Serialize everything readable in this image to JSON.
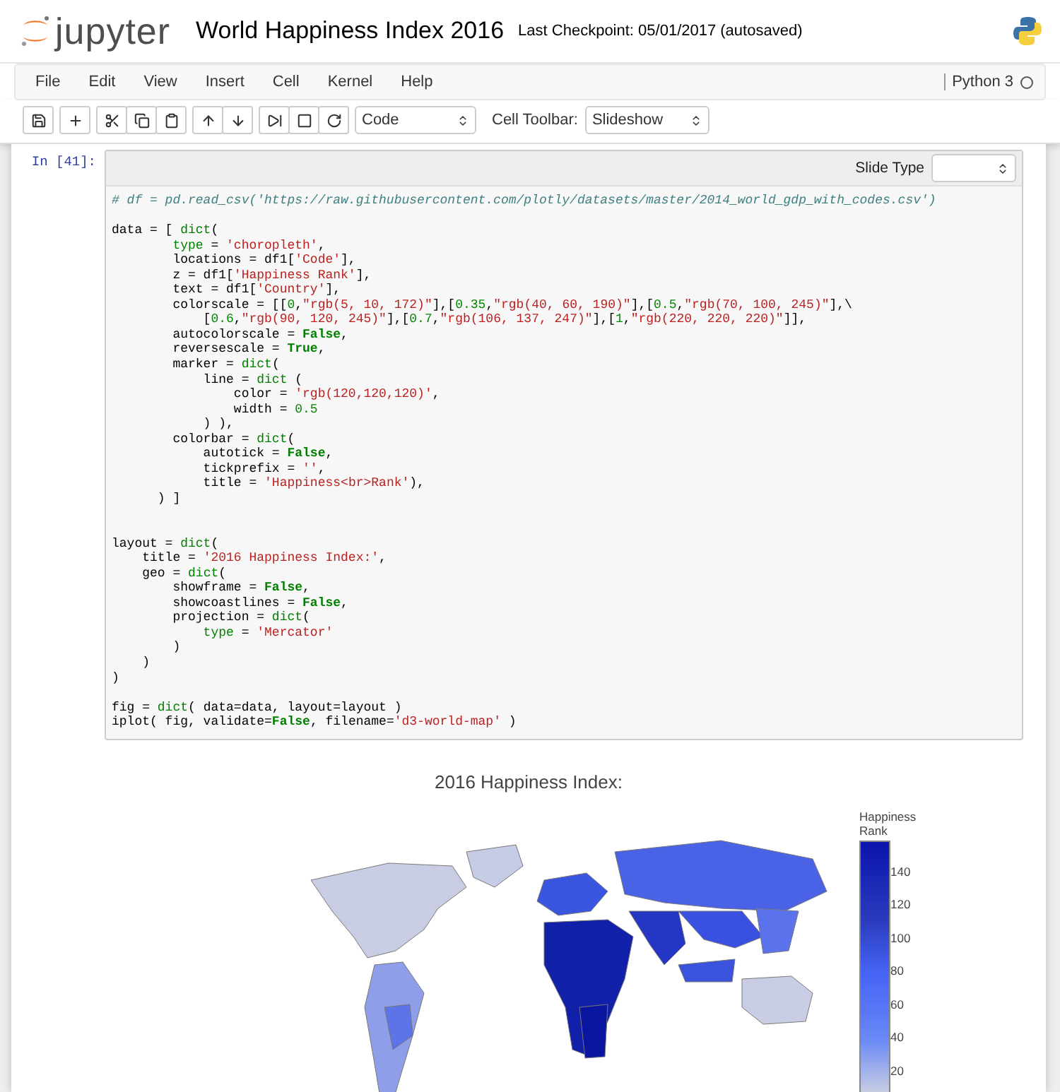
{
  "header": {
    "logo_text": "jupyter",
    "notebook_title": "World Happiness Index 2016",
    "checkpoint": "Last Checkpoint: 05/01/2017 (autosaved)"
  },
  "menu": [
    "File",
    "Edit",
    "View",
    "Insert",
    "Cell",
    "Kernel",
    "Help"
  ],
  "kernel": {
    "name": "Python 3",
    "busy": false
  },
  "toolbar": {
    "cell_type": "Code",
    "cell_toolbar_label": "Cell Toolbar:",
    "cell_toolbar_value": "Slideshow"
  },
  "cell": {
    "prompt": "In [41]:",
    "slide_type_label": "Slide Type",
    "code": [
      {
        "tokens": [
          {
            "kind": "comment",
            "text": "# df = pd.read_csv('https://raw.githubusercontent.com/plotly/datasets/master/2014_world_gdp_with_codes.csv')"
          }
        ]
      },
      {
        "blank_before": true,
        "tokens": [
          {
            "kind": "plain",
            "text": "data = [ "
          },
          {
            "kind": "builtin",
            "text": "dict"
          },
          {
            "kind": "plain",
            "text": "("
          }
        ]
      },
      {
        "tokens": [
          {
            "kind": "builtin",
            "text": "        type"
          },
          {
            "kind": "plain",
            "text": " = "
          },
          {
            "kind": "string",
            "text": "'choropleth'"
          },
          {
            "kind": "plain",
            "text": ","
          }
        ]
      },
      {
        "tokens": [
          {
            "kind": "plain",
            "text": "        locations = df1["
          },
          {
            "kind": "string",
            "text": "'Code'"
          },
          {
            "kind": "plain",
            "text": "],"
          }
        ]
      },
      {
        "tokens": [
          {
            "kind": "plain",
            "text": "        z = df1["
          },
          {
            "kind": "string",
            "text": "'Happiness Rank'"
          },
          {
            "kind": "plain",
            "text": "],"
          }
        ]
      },
      {
        "tokens": [
          {
            "kind": "plain",
            "text": "        text = df1["
          },
          {
            "kind": "string",
            "text": "'Country'"
          },
          {
            "kind": "plain",
            "text": "],"
          }
        ]
      },
      {
        "tokens": [
          {
            "kind": "plain",
            "text": "        colorscale = [["
          },
          {
            "kind": "number",
            "text": "0"
          },
          {
            "kind": "plain",
            "text": ","
          },
          {
            "kind": "string",
            "text": "\"rgb(5, 10, 172)\""
          },
          {
            "kind": "plain",
            "text": "],["
          },
          {
            "kind": "number",
            "text": "0.35"
          },
          {
            "kind": "plain",
            "text": ","
          },
          {
            "kind": "string",
            "text": "\"rgb(40, 60, 190)\""
          },
          {
            "kind": "plain",
            "text": "],["
          },
          {
            "kind": "number",
            "text": "0.5"
          },
          {
            "kind": "plain",
            "text": ","
          },
          {
            "kind": "string",
            "text": "\"rgb(70, 100, 245)\""
          },
          {
            "kind": "plain",
            "text": "],\\"
          }
        ]
      },
      {
        "tokens": [
          {
            "kind": "plain",
            "text": "            ["
          },
          {
            "kind": "number",
            "text": "0.6"
          },
          {
            "kind": "plain",
            "text": ","
          },
          {
            "kind": "string",
            "text": "\"rgb(90, 120, 245)\""
          },
          {
            "kind": "plain",
            "text": "],["
          },
          {
            "kind": "number",
            "text": "0.7"
          },
          {
            "kind": "plain",
            "text": ","
          },
          {
            "kind": "string",
            "text": "\"rgb(106, 137, 247)\""
          },
          {
            "kind": "plain",
            "text": "],["
          },
          {
            "kind": "number",
            "text": "1"
          },
          {
            "kind": "plain",
            "text": ","
          },
          {
            "kind": "string",
            "text": "\"rgb(220, 220, 220)\""
          },
          {
            "kind": "plain",
            "text": "]],"
          }
        ]
      },
      {
        "tokens": [
          {
            "kind": "plain",
            "text": "        autocolorscale = "
          },
          {
            "kind": "keyword",
            "text": "False"
          },
          {
            "kind": "plain",
            "text": ","
          }
        ]
      },
      {
        "tokens": [
          {
            "kind": "plain",
            "text": "        reversescale = "
          },
          {
            "kind": "keyword",
            "text": "True"
          },
          {
            "kind": "plain",
            "text": ","
          }
        ]
      },
      {
        "tokens": [
          {
            "kind": "plain",
            "text": "        marker = "
          },
          {
            "kind": "builtin",
            "text": "dict"
          },
          {
            "kind": "plain",
            "text": "("
          }
        ]
      },
      {
        "tokens": [
          {
            "kind": "plain",
            "text": "            line = "
          },
          {
            "kind": "builtin",
            "text": "dict"
          },
          {
            "kind": "plain",
            "text": " ("
          }
        ]
      },
      {
        "tokens": [
          {
            "kind": "plain",
            "text": "                color = "
          },
          {
            "kind": "string",
            "text": "'rgb(120,120,120)'"
          },
          {
            "kind": "plain",
            "text": ","
          }
        ]
      },
      {
        "tokens": [
          {
            "kind": "plain",
            "text": "                width = "
          },
          {
            "kind": "number",
            "text": "0.5"
          }
        ]
      },
      {
        "tokens": [
          {
            "kind": "plain",
            "text": "            ) ),"
          }
        ]
      },
      {
        "tokens": [
          {
            "kind": "plain",
            "text": "        colorbar = "
          },
          {
            "kind": "builtin",
            "text": "dict"
          },
          {
            "kind": "plain",
            "text": "("
          }
        ]
      },
      {
        "tokens": [
          {
            "kind": "plain",
            "text": "            autotick = "
          },
          {
            "kind": "keyword",
            "text": "False"
          },
          {
            "kind": "plain",
            "text": ","
          }
        ]
      },
      {
        "tokens": [
          {
            "kind": "plain",
            "text": "            tickprefix = "
          },
          {
            "kind": "string",
            "text": "''"
          },
          {
            "kind": "plain",
            "text": ","
          }
        ]
      },
      {
        "tokens": [
          {
            "kind": "plain",
            "text": "            title = "
          },
          {
            "kind": "string",
            "text": "'Happiness<br>Rank'"
          },
          {
            "kind": "plain",
            "text": "),"
          }
        ]
      },
      {
        "tokens": [
          {
            "kind": "plain",
            "text": "      ) ]"
          }
        ]
      },
      {
        "blank_before": true,
        "extra_blank_before": true,
        "tokens": [
          {
            "kind": "plain",
            "text": "layout = "
          },
          {
            "kind": "builtin",
            "text": "dict"
          },
          {
            "kind": "plain",
            "text": "("
          }
        ]
      },
      {
        "tokens": [
          {
            "kind": "plain",
            "text": "    title = "
          },
          {
            "kind": "string",
            "text": "'2016 Happiness Index:'"
          },
          {
            "kind": "plain",
            "text": ","
          }
        ]
      },
      {
        "tokens": [
          {
            "kind": "plain",
            "text": "    geo = "
          },
          {
            "kind": "builtin",
            "text": "dict"
          },
          {
            "kind": "plain",
            "text": "("
          }
        ]
      },
      {
        "tokens": [
          {
            "kind": "plain",
            "text": "        showframe = "
          },
          {
            "kind": "keyword",
            "text": "False"
          },
          {
            "kind": "plain",
            "text": ","
          }
        ]
      },
      {
        "tokens": [
          {
            "kind": "plain",
            "text": "        showcoastlines = "
          },
          {
            "kind": "keyword",
            "text": "False"
          },
          {
            "kind": "plain",
            "text": ","
          }
        ]
      },
      {
        "tokens": [
          {
            "kind": "plain",
            "text": "        projection = "
          },
          {
            "kind": "builtin",
            "text": "dict"
          },
          {
            "kind": "plain",
            "text": "("
          }
        ]
      },
      {
        "tokens": [
          {
            "kind": "builtin",
            "text": "            type"
          },
          {
            "kind": "plain",
            "text": " = "
          },
          {
            "kind": "string",
            "text": "'Mercator'"
          }
        ]
      },
      {
        "tokens": [
          {
            "kind": "plain",
            "text": "        )"
          }
        ]
      },
      {
        "tokens": [
          {
            "kind": "plain",
            "text": "    )"
          }
        ]
      },
      {
        "tokens": [
          {
            "kind": "plain",
            "text": ")"
          }
        ]
      },
      {
        "blank_before": true,
        "tokens": [
          {
            "kind": "plain",
            "text": "fig = "
          },
          {
            "kind": "builtin",
            "text": "dict"
          },
          {
            "kind": "plain",
            "text": "( data=data, layout=layout )"
          }
        ]
      },
      {
        "tokens": [
          {
            "kind": "plain",
            "text": "iplot( fig, validate="
          },
          {
            "kind": "keyword",
            "text": "False"
          },
          {
            "kind": "plain",
            "text": ", filename="
          },
          {
            "kind": "string",
            "text": "'d3-world-map'"
          },
          {
            "kind": "plain",
            "text": " )"
          }
        ]
      }
    ]
  },
  "output": {
    "title": "2016 Happiness Index:",
    "colorbar": {
      "title_lines": [
        "Happiness",
        "Rank"
      ],
      "ticks": [
        "140",
        "120",
        "100",
        "80",
        "60",
        "40",
        "20"
      ]
    }
  }
}
